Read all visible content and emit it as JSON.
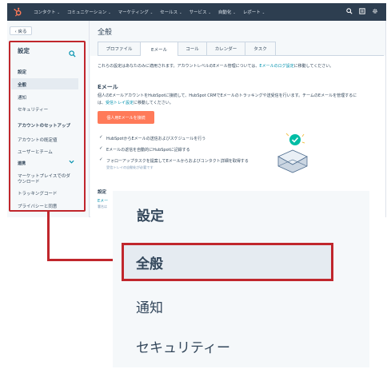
{
  "nav": {
    "items": [
      "コンタクト",
      "コミュニケーション",
      "マーケティング",
      "セールス",
      "サービス",
      "自動化",
      "レポート"
    ],
    "chevron": "⌄"
  },
  "sidebar": {
    "back_label": "‹ 戻る",
    "title": "設定",
    "section_settings": "設定",
    "items": [
      "全般",
      "通知",
      "セキュリティー"
    ],
    "section_account": "アカウントのセットアップ",
    "account_items": [
      "アカウントの既定値",
      "ユーザーとチーム"
    ],
    "integrations": "連携",
    "integration_items": [
      "マーケットプレイスでのダ",
      "ウンロード",
      "トラッキングコード",
      "プライバシーと同意"
    ]
  },
  "main": {
    "title": "全般",
    "tabs": [
      "プロファイル",
      "Eメール",
      "コール",
      "カレンダー",
      "タスク"
    ],
    "active_tab": "Eメール",
    "notice": "これらの設定はあなたのみに適用されます。アカウントレベルのEメール管理については、",
    "notice_link": "Eメールのログ設定",
    "notice_end": "に移動してください。",
    "section_title": "Eメール",
    "desc1": "個人のEメールアカウントをHubSpotに接続して、HubSpot CRMでEメールのトラッキングや送受信を行います。チームのEメールを管理するに",
    "desc2_pre": "は、",
    "desc2_link": "受信トレイ設定",
    "desc2_end": "に移動してください。",
    "connect_button": "個人用Eメールを接続",
    "features": [
      "HubSpotからEメールの送信およびスケジュールを行う",
      "Eメールの返信を自動的にHubSpotに記録する",
      "フォローアップタスクを提案してEメールからおよびコンタクト詳細を取得する"
    ],
    "feature_note": "受信トレイの自動化が必要です",
    "lower_title": "設定",
    "lower_text": "Eメー",
    "lower_small": "署名は"
  },
  "zoom": {
    "heading": "設定",
    "active": "全般",
    "items": [
      "通知",
      "セキュリティー"
    ]
  },
  "colors": {
    "accent": "#c0262c",
    "nav_bg": "#2d3e50",
    "button": "#ff7a59",
    "link": "#0091ae"
  }
}
